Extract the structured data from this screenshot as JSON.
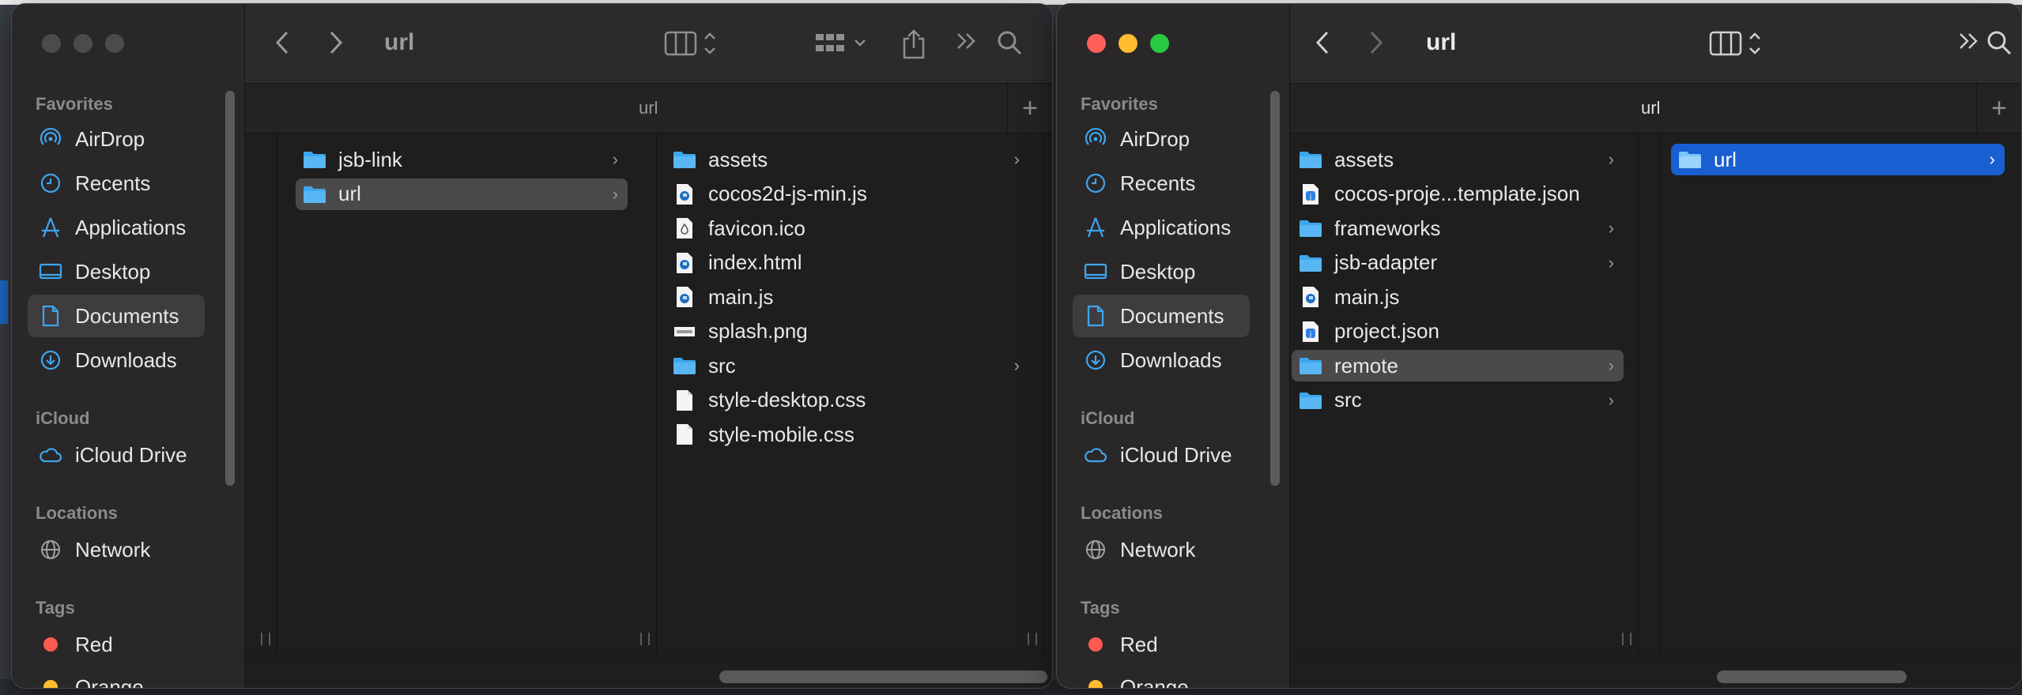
{
  "colors": {
    "accent": "#1a5fd1",
    "folder": "#3ea6ee",
    "red_tag": "#ff5a52",
    "orange_tag": "#ffbd2e"
  },
  "win1": {
    "title": "url",
    "tab_label": "url",
    "sidebar": {
      "favorites_label": "Favorites",
      "favorites": [
        {
          "label": "AirDrop",
          "icon": "airdrop-icon"
        },
        {
          "label": "Recents",
          "icon": "clock-icon"
        },
        {
          "label": "Applications",
          "icon": "applications-icon"
        },
        {
          "label": "Desktop",
          "icon": "desktop-icon"
        },
        {
          "label": "Documents",
          "icon": "document-icon"
        },
        {
          "label": "Downloads",
          "icon": "download-icon"
        }
      ],
      "icloud_label": "iCloud",
      "icloud_drive": "iCloud Drive",
      "locations_label": "Locations",
      "network": "Network",
      "tags_label": "Tags",
      "tags": [
        {
          "label": "Red"
        },
        {
          "label": "Orange"
        }
      ]
    },
    "col1": [
      {
        "name": "jsb-link",
        "type": "folder"
      },
      {
        "name": "url",
        "type": "folder",
        "selected": true
      }
    ],
    "col2": [
      {
        "name": "assets",
        "type": "folder"
      },
      {
        "name": "cocos2d-js-min.js",
        "type": "js"
      },
      {
        "name": "favicon.ico",
        "type": "ico"
      },
      {
        "name": "index.html",
        "type": "js"
      },
      {
        "name": "main.js",
        "type": "js"
      },
      {
        "name": "splash.png",
        "type": "png"
      },
      {
        "name": "src",
        "type": "folder"
      },
      {
        "name": "style-desktop.css",
        "type": "file"
      },
      {
        "name": "style-mobile.css",
        "type": "file"
      }
    ]
  },
  "win2": {
    "title": "url",
    "tab_label": "url",
    "col1": [
      {
        "name": "assets",
        "type": "folder"
      },
      {
        "name": "cocos-proje...template.json",
        "type": "json"
      },
      {
        "name": "frameworks",
        "type": "folder"
      },
      {
        "name": "jsb-adapter",
        "type": "folder"
      },
      {
        "name": "main.js",
        "type": "js"
      },
      {
        "name": "project.json",
        "type": "json"
      },
      {
        "name": "remote",
        "type": "folder",
        "selected": true
      },
      {
        "name": "src",
        "type": "folder"
      }
    ],
    "col2": [
      {
        "name": "url",
        "type": "folder",
        "selected": true
      }
    ]
  }
}
